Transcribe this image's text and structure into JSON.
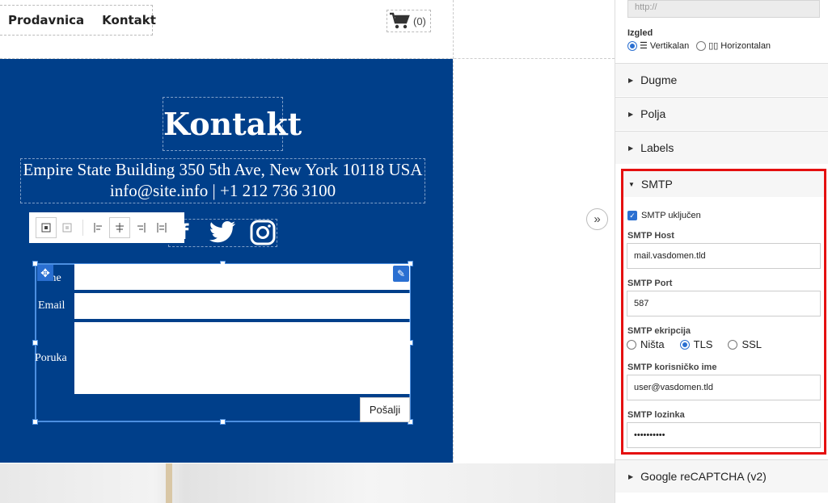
{
  "nav": {
    "items": [
      "Prodavnica",
      "Kontakt"
    ]
  },
  "cart": {
    "count": "(0)"
  },
  "contact": {
    "title": "Kontakt",
    "address": "Empire State Building 350 5th Ave, New York 10118 USA",
    "line2": "info@site.info  |  +1 212 736 3100"
  },
  "form": {
    "labels": [
      "Ime",
      "Email",
      "Poruka"
    ],
    "submit": "Pošalji"
  },
  "panel": {
    "url_placeholder": "http://",
    "izgled": {
      "label": "Izgled",
      "options": [
        "Vertikalan",
        "Horizontalan"
      ],
      "selected": "Vertikalan"
    },
    "sections": [
      "Dugme",
      "Polja",
      "Labels"
    ],
    "smtp": {
      "title": "SMTP",
      "enabled_label": "SMTP uključen",
      "enabled": true,
      "host_label": "SMTP Host",
      "host_value": "mail.vasdomen.tld",
      "port_label": "SMTP Port",
      "port_value": "587",
      "encryption_label": "SMTP ekripcija",
      "encryption_options": [
        "Ništa",
        "TLS",
        "SSL"
      ],
      "encryption_selected": "TLS",
      "user_label": "SMTP korisničko ime",
      "user_value": "user@vasdomen.tld",
      "password_label": "SMTP lozinka",
      "password_value": "••••••••••"
    },
    "recaptcha": "Google reCAPTCHA (v2)"
  },
  "colors": {
    "site_blue": "#003f8a",
    "accent": "#2a6fd1",
    "highlight": "#e51010"
  }
}
